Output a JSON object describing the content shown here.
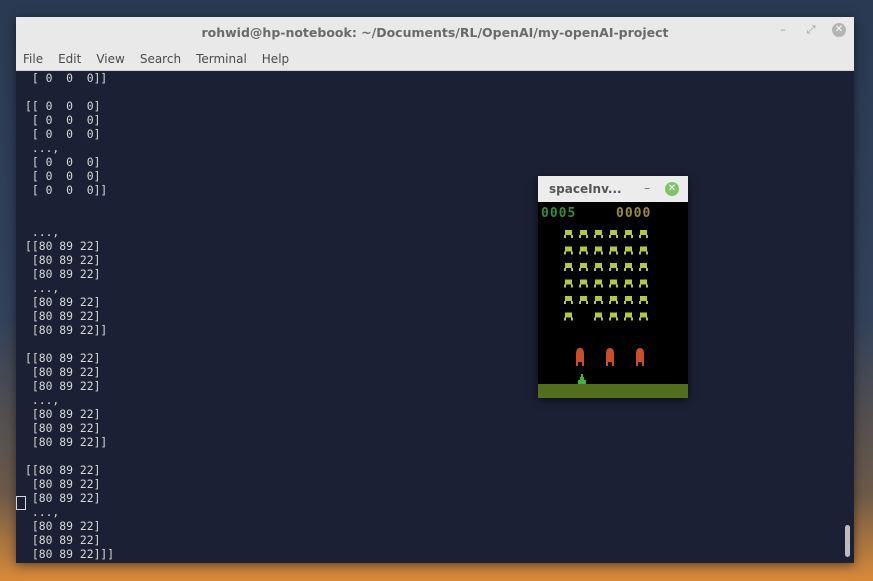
{
  "window": {
    "title": "rohwid@hp-notebook: ~/Documents/RL/OpenAI/my-openAI-project",
    "controls": [
      "–",
      "⤢",
      "✕"
    ]
  },
  "menu": [
    "File",
    "Edit",
    "View",
    "Search",
    "Terminal",
    "Help"
  ],
  "terminal_lines": [
    " [ 0  0  0]]",
    "",
    "[[ 0  0  0]",
    " [ 0  0  0]",
    " [ 0  0  0]",
    " ...,",
    " [ 0  0  0]",
    " [ 0  0  0]",
    " [ 0  0  0]]",
    "",
    "",
    " ...,",
    "[[80 89 22]",
    " [80 89 22]",
    " [80 89 22]",
    " ...,",
    " [80 89 22]",
    " [80 89 22]",
    " [80 89 22]]",
    "",
    "[[80 89 22]",
    " [80 89 22]",
    " [80 89 22]",
    " ...,",
    " [80 89 22]",
    " [80 89 22]",
    " [80 89 22]]",
    "",
    "[[80 89 22]",
    " [80 89 22]",
    " [80 89 22]",
    " ...,",
    " [80 89 22]",
    " [80 89 22]",
    " [80 89 22]]]"
  ],
  "game_window": {
    "title": "spaceInv...",
    "minimize": "–",
    "close": "✕",
    "score_left": "0005",
    "score_right": "0000",
    "colors": {
      "score_left": "#3a8a3a",
      "score_right": "#9a8a4a",
      "aliens": "#b4c83c",
      "bunkers": "#c8502c",
      "player": "#3cb43c",
      "ground": "#506e1e"
    }
  }
}
